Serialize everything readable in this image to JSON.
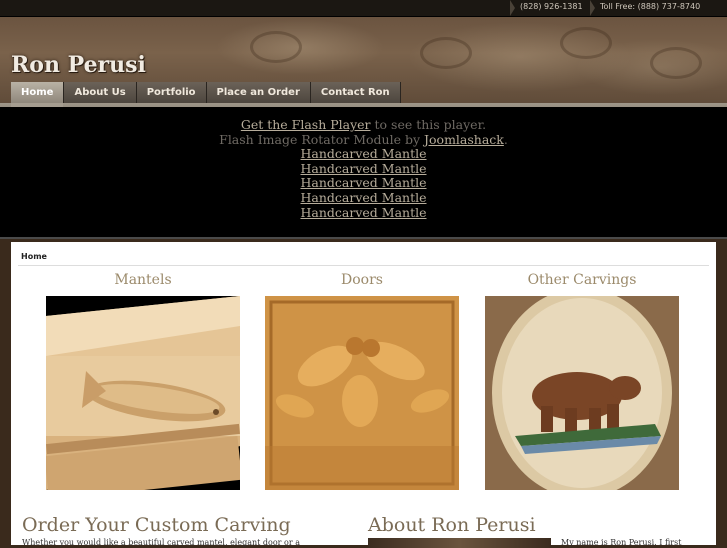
{
  "topbar": {
    "phone": "(828) 926-1381",
    "tollfree": "Toll Free: (888) 737-8740"
  },
  "header": {
    "logo": "Ron Perusi"
  },
  "nav": {
    "items": [
      {
        "label": "Home",
        "active": true
      },
      {
        "label": "About Us",
        "active": false
      },
      {
        "label": "Portfolio",
        "active": false
      },
      {
        "label": "Place an Order",
        "active": false
      },
      {
        "label": "Contact Ron",
        "active": false
      }
    ]
  },
  "flash": {
    "get_player_link": "Get the Flash Player",
    "get_player_suffix": " to see this player.",
    "rotator_text": "Flash Image Rotator Module by ",
    "rotator_link": "Joomlashack",
    "rotator_suffix": ".",
    "mantles": [
      "Handcarved Mantle",
      "Handcarved Mantle",
      "Handcarved Mantle",
      "Handcarved Mantle",
      "Handcarved Mantle"
    ]
  },
  "content": {
    "breadcrumb": "Home",
    "columns": [
      {
        "title": "Mantels",
        "image": "carved-fish-mantel"
      },
      {
        "title": "Doors",
        "image": "carved-oak-leaf-door"
      },
      {
        "title": "Other Carvings",
        "image": "carved-bear-plaque"
      }
    ],
    "order_title": "Order Your Custom Carving",
    "order_text": "Whether you would like a beautiful carved mantel, elegant door or a",
    "about_title": "About Ron Perusi",
    "about_text": "My name is Ron Perusi. I first"
  },
  "colors": {
    "accent_title": "#9b8a6b",
    "link": "#b7ad9b",
    "background": "#3a2a1c"
  }
}
